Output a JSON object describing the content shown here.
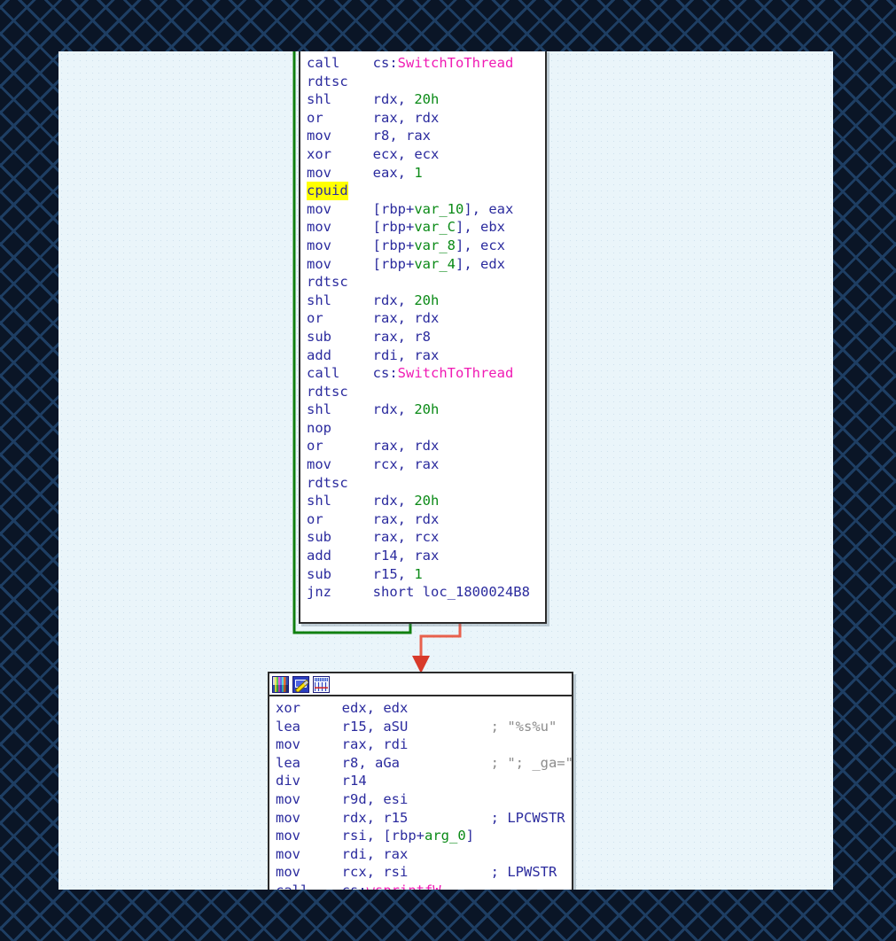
{
  "app": {
    "view": "IDA Pro graph view",
    "background_color": "#0a1526",
    "panel_color": "#eaf5fa"
  },
  "colors": {
    "mnemonic": "#2b2b9e",
    "number": "#0a8a16",
    "variable": "#0a8a16",
    "api_name": "#f01ab4",
    "string_comment": "#8c8c8c",
    "type_comment": "#2b2b9e",
    "highlight": "#ffff00",
    "loop_edge": "#108010",
    "jump_edge": "#e8604c"
  },
  "blocks": [
    {
      "name": "loop-block",
      "has_titlebar": false,
      "lines": [
        {
          "mnemonic": "call",
          "operands": [
            {
              "text": "cs:",
              "kind": "op"
            },
            {
              "text": "SwitchToThread",
              "kind": "api"
            }
          ]
        },
        {
          "mnemonic": "rdtsc",
          "operands": []
        },
        {
          "mnemonic": "shl",
          "operands": [
            {
              "text": "rdx, ",
              "kind": "op"
            },
            {
              "text": "20h",
              "kind": "num"
            }
          ]
        },
        {
          "mnemonic": "or",
          "operands": [
            {
              "text": "rax, rdx",
              "kind": "op"
            }
          ]
        },
        {
          "mnemonic": "mov",
          "operands": [
            {
              "text": "r8, rax",
              "kind": "op"
            }
          ]
        },
        {
          "mnemonic": "xor",
          "operands": [
            {
              "text": "ecx, ecx",
              "kind": "op"
            }
          ]
        },
        {
          "mnemonic": "mov",
          "operands": [
            {
              "text": "eax, ",
              "kind": "op"
            },
            {
              "text": "1",
              "kind": "num"
            }
          ]
        },
        {
          "mnemonic": "cpuid",
          "highlight": true,
          "operands": []
        },
        {
          "mnemonic": "mov",
          "operands": [
            {
              "text": "[rbp+",
              "kind": "op"
            },
            {
              "text": "var_10",
              "kind": "var"
            },
            {
              "text": "], eax",
              "kind": "op"
            }
          ]
        },
        {
          "mnemonic": "mov",
          "operands": [
            {
              "text": "[rbp+",
              "kind": "op"
            },
            {
              "text": "var_C",
              "kind": "var"
            },
            {
              "text": "], ebx",
              "kind": "op"
            }
          ]
        },
        {
          "mnemonic": "mov",
          "operands": [
            {
              "text": "[rbp+",
              "kind": "op"
            },
            {
              "text": "var_8",
              "kind": "var"
            },
            {
              "text": "], ecx",
              "kind": "op"
            }
          ]
        },
        {
          "mnemonic": "mov",
          "operands": [
            {
              "text": "[rbp+",
              "kind": "op"
            },
            {
              "text": "var_4",
              "kind": "var"
            },
            {
              "text": "], edx",
              "kind": "op"
            }
          ]
        },
        {
          "mnemonic": "rdtsc",
          "operands": []
        },
        {
          "mnemonic": "shl",
          "operands": [
            {
              "text": "rdx, ",
              "kind": "op"
            },
            {
              "text": "20h",
              "kind": "num"
            }
          ]
        },
        {
          "mnemonic": "or",
          "operands": [
            {
              "text": "rax, rdx",
              "kind": "op"
            }
          ]
        },
        {
          "mnemonic": "sub",
          "operands": [
            {
              "text": "rax, r8",
              "kind": "op"
            }
          ]
        },
        {
          "mnemonic": "add",
          "operands": [
            {
              "text": "rdi, rax",
              "kind": "op"
            }
          ]
        },
        {
          "mnemonic": "call",
          "operands": [
            {
              "text": "cs:",
              "kind": "op"
            },
            {
              "text": "SwitchToThread",
              "kind": "api"
            }
          ]
        },
        {
          "mnemonic": "rdtsc",
          "operands": []
        },
        {
          "mnemonic": "shl",
          "operands": [
            {
              "text": "rdx, ",
              "kind": "op"
            },
            {
              "text": "20h",
              "kind": "num"
            }
          ]
        },
        {
          "mnemonic": "nop",
          "operands": []
        },
        {
          "mnemonic": "or",
          "operands": [
            {
              "text": "rax, rdx",
              "kind": "op"
            }
          ]
        },
        {
          "mnemonic": "mov",
          "operands": [
            {
              "text": "rcx, rax",
              "kind": "op"
            }
          ]
        },
        {
          "mnemonic": "rdtsc",
          "operands": []
        },
        {
          "mnemonic": "shl",
          "operands": [
            {
              "text": "rdx, ",
              "kind": "op"
            },
            {
              "text": "20h",
              "kind": "num"
            }
          ]
        },
        {
          "mnemonic": "or",
          "operands": [
            {
              "text": "rax, rdx",
              "kind": "op"
            }
          ]
        },
        {
          "mnemonic": "sub",
          "operands": [
            {
              "text": "rax, rcx",
              "kind": "op"
            }
          ]
        },
        {
          "mnemonic": "add",
          "operands": [
            {
              "text": "r14, rax",
              "kind": "op"
            }
          ]
        },
        {
          "mnemonic": "sub",
          "operands": [
            {
              "text": "r15, ",
              "kind": "op"
            },
            {
              "text": "1",
              "kind": "num"
            }
          ]
        },
        {
          "mnemonic": "jnz",
          "operands": [
            {
              "text": "short loc_1800024B8",
              "kind": "op"
            }
          ]
        }
      ]
    },
    {
      "name": "wsprintf-block",
      "has_titlebar": true,
      "titlebar_icons": [
        "palette-icon",
        "pencil-edit-icon",
        "chart-window-icon"
      ],
      "lines": [
        {
          "mnemonic": "xor",
          "operands": [
            {
              "text": "edx, edx",
              "kind": "op"
            }
          ]
        },
        {
          "mnemonic": "lea",
          "operands": [
            {
              "text": "r15, aSU",
              "kind": "op"
            }
          ],
          "comment": "; \"%s%u\"",
          "comment_kind": "string"
        },
        {
          "mnemonic": "mov",
          "operands": [
            {
              "text": "rax, rdi",
              "kind": "op"
            }
          ]
        },
        {
          "mnemonic": "lea",
          "operands": [
            {
              "text": "r8, aGa",
              "kind": "op"
            }
          ],
          "comment": "; \"; _ga=\"",
          "comment_kind": "string"
        },
        {
          "mnemonic": "div",
          "operands": [
            {
              "text": "r14",
              "kind": "op"
            }
          ]
        },
        {
          "mnemonic": "mov",
          "operands": [
            {
              "text": "r9d, esi",
              "kind": "op"
            }
          ]
        },
        {
          "mnemonic": "mov",
          "operands": [
            {
              "text": "rdx, r15",
              "kind": "op"
            }
          ],
          "comment": "; LPCWSTR",
          "comment_kind": "type"
        },
        {
          "mnemonic": "mov",
          "operands": [
            {
              "text": "rsi, [rbp+",
              "kind": "op"
            },
            {
              "text": "arg_0",
              "kind": "var"
            },
            {
              "text": "]",
              "kind": "op"
            }
          ]
        },
        {
          "mnemonic": "mov",
          "operands": [
            {
              "text": "rdi, rax",
              "kind": "op"
            }
          ]
        },
        {
          "mnemonic": "mov",
          "operands": [
            {
              "text": "rcx, rsi",
              "kind": "op"
            }
          ],
          "comment": "; LPWSTR",
          "comment_kind": "type"
        },
        {
          "mnemonic": "call",
          "operands": [
            {
              "text": "cs:",
              "kind": "op"
            },
            {
              "text": "wsprintfW",
              "kind": "api"
            }
          ]
        }
      ]
    }
  ]
}
